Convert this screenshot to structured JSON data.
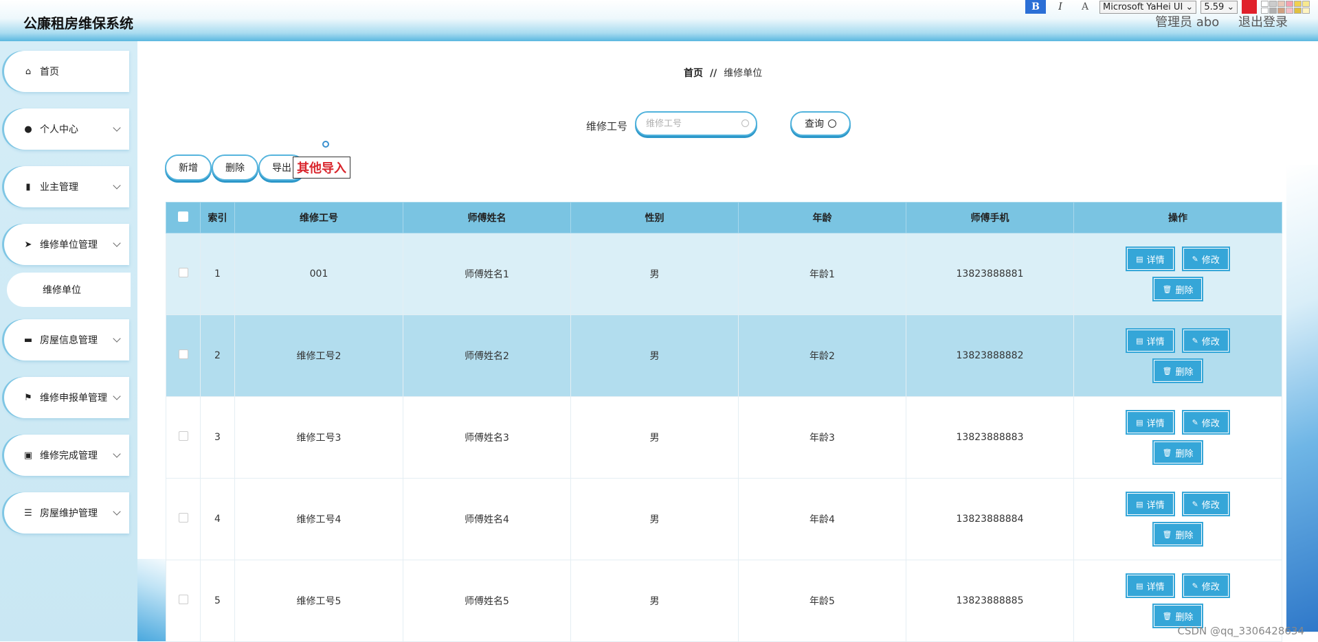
{
  "header": {
    "title": "公廉租房维保系统",
    "user": "管理员 abo",
    "logout": "退出登录"
  },
  "editor_toolbar": {
    "bold": "B",
    "italic": "I",
    "font_color": "A",
    "font_family": "Microsoft YaHei UI",
    "font_size": "5.59",
    "accent": "#e0212b",
    "swatches": [
      "#ffffff",
      "#cccccc",
      "#e8c8b8",
      "#f4a0b0",
      "#f0d050",
      "#f7e890",
      "#ffffff",
      "#b0b0b0",
      "#d0a080",
      "#f4c0c8",
      "#e0c040",
      "#fff4c0"
    ]
  },
  "sidebar": {
    "items": [
      {
        "label": "首页",
        "icon": "home-icon",
        "glyph": "⌂"
      },
      {
        "label": "个人中心",
        "icon": "user-icon",
        "glyph": "●"
      },
      {
        "label": "业主管理",
        "icon": "bar-chart-icon",
        "glyph": "▮"
      },
      {
        "label": "维修单位管理",
        "icon": "send-icon",
        "glyph": "➤"
      },
      {
        "label": "房屋信息管理",
        "icon": "print-icon",
        "glyph": "▬"
      },
      {
        "label": "维修申报单管理",
        "icon": "flag-icon",
        "glyph": "⚑"
      },
      {
        "label": "维修完成管理",
        "icon": "clipboard-icon",
        "glyph": "▣"
      },
      {
        "label": "房屋维护管理",
        "icon": "list-icon",
        "glyph": "☰"
      }
    ],
    "sub_item": "维修单位"
  },
  "breadcrumb": {
    "home": "首页",
    "sep": "//",
    "current": "维修单位"
  },
  "search": {
    "label": "维修工号",
    "placeholder": "维修工号",
    "button": "查询"
  },
  "actions": {
    "add": "新增",
    "delete": "删除",
    "export": "导出",
    "other_import": "其他导入"
  },
  "table": {
    "columns": [
      "索引",
      "维修工号",
      "师傅姓名",
      "性别",
      "年龄",
      "师傅手机",
      "操作"
    ],
    "rows": [
      {
        "index": "1",
        "code": "001",
        "name": "师傅姓名1",
        "gender": "男",
        "age": "年龄1",
        "phone": "13823888881"
      },
      {
        "index": "2",
        "code": "维修工号2",
        "name": "师傅姓名2",
        "gender": "男",
        "age": "年龄2",
        "phone": "13823888882"
      },
      {
        "index": "3",
        "code": "维修工号3",
        "name": "师傅姓名3",
        "gender": "男",
        "age": "年龄3",
        "phone": "13823888883"
      },
      {
        "index": "4",
        "code": "维修工号4",
        "name": "师傅姓名4",
        "gender": "男",
        "age": "年龄4",
        "phone": "13823888884"
      },
      {
        "index": "5",
        "code": "维修工号5",
        "name": "师傅姓名5",
        "gender": "男",
        "age": "年龄5",
        "phone": "13823888885"
      }
    ],
    "ops": {
      "detail": "详情",
      "edit": "修改",
      "delete": "删除"
    }
  },
  "watermark": "CSDN @qq_3306428634"
}
